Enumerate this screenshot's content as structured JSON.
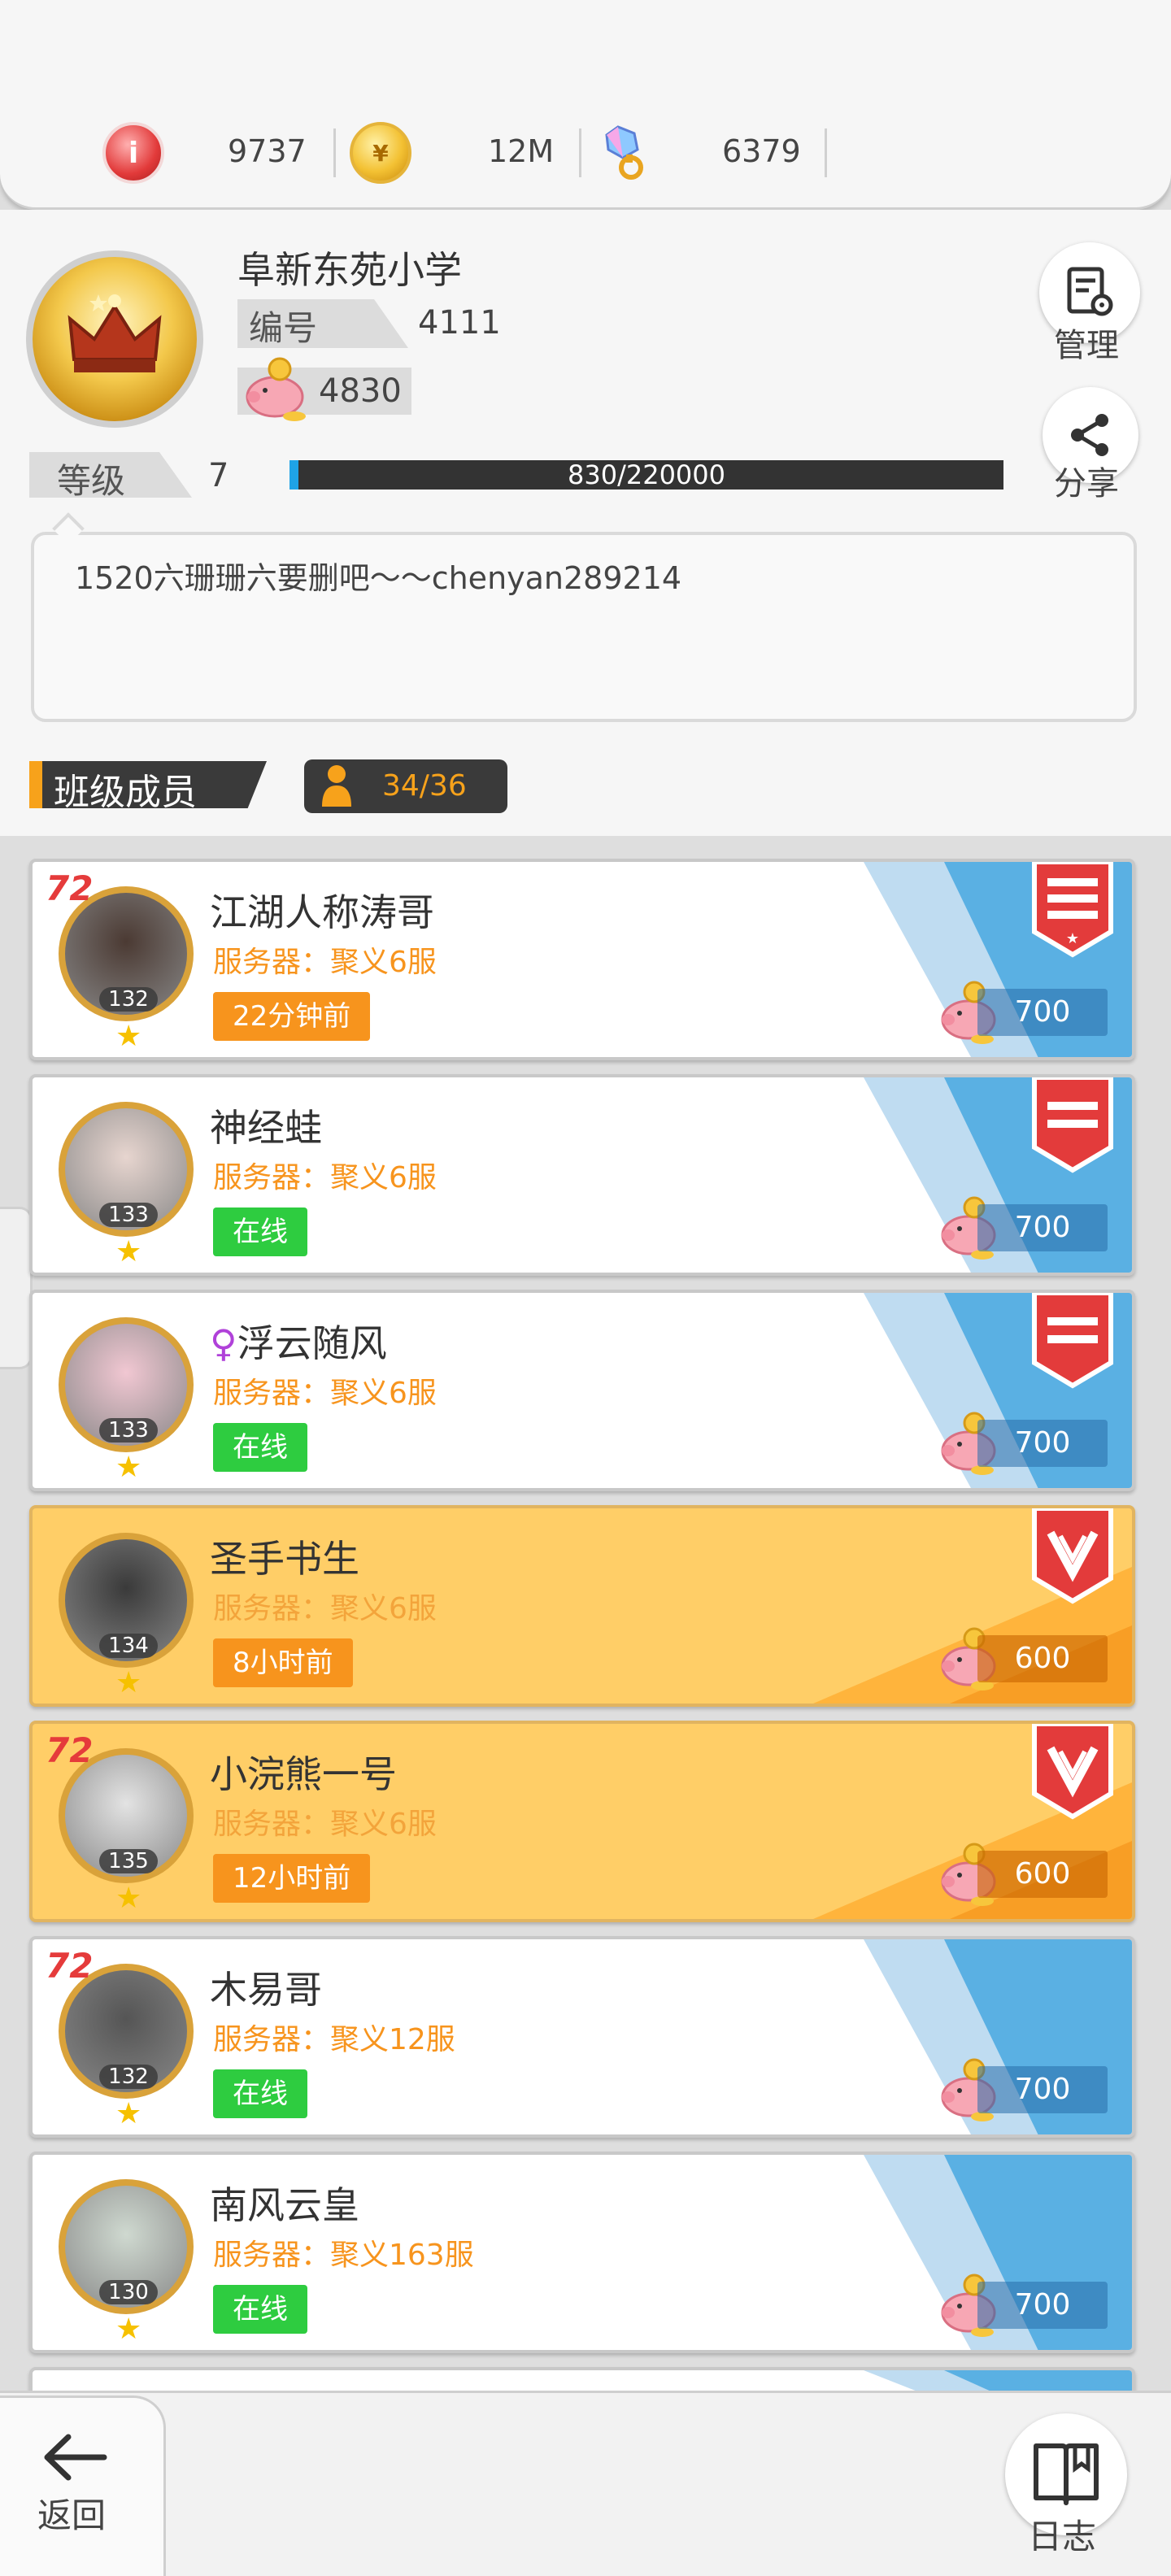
{
  "currencies": [
    {
      "icon": "gem-icon",
      "value": "9737"
    },
    {
      "icon": "gold-coin-icon",
      "value": "12M"
    },
    {
      "icon": "crystal-key-icon",
      "value": "6379"
    }
  ],
  "school": {
    "name": "阜新东苑小学",
    "id_label": "编号",
    "id_value": "4111",
    "pig_value": "4830",
    "level_label": "等级",
    "level_value": "7",
    "xp_text": "830/220000",
    "xp_fraction": 0.0038,
    "manage_label": "管理",
    "share_label": "分享",
    "motto": "1520六珊珊六要删吧～～chenyan289214"
  },
  "members_section": {
    "title": "班级成员",
    "count": "34/36"
  },
  "members": [
    {
      "name": "江湖人称涛哥",
      "server": "服务器：聚义6服",
      "status": "22分钟前",
      "status_type": "away",
      "level": "132",
      "score": "700",
      "vip": "72",
      "role": "leader-icon",
      "card": "white"
    },
    {
      "name": "神经蛙",
      "server": "服务器：聚义6服",
      "status": "在线",
      "status_type": "online",
      "level": "133",
      "score": "700",
      "vip": "",
      "role": "officer-icon",
      "card": "white"
    },
    {
      "name": "浮云随风",
      "server": "服务器：聚义6服",
      "status": "在线",
      "status_type": "online",
      "level": "133",
      "score": "700",
      "vip": "",
      "role": "officer-icon",
      "card": "white",
      "gender": "♀"
    },
    {
      "name": "圣手书生",
      "server": "服务器：聚义6服",
      "status": "8小时前",
      "status_type": "away",
      "level": "134",
      "score": "600",
      "vip": "",
      "role": "elite-icon",
      "card": "gold"
    },
    {
      "name": "小浣熊一号",
      "server": "服务器：聚义6服",
      "status": "12小时前",
      "status_type": "away",
      "level": "135",
      "score": "600",
      "vip": "72",
      "role": "elite-icon",
      "card": "gold"
    },
    {
      "name": "木易哥",
      "server": "服务器：聚义12服",
      "status": "在线",
      "status_type": "online",
      "level": "132",
      "score": "700",
      "vip": "72",
      "role": "",
      "card": "white"
    },
    {
      "name": "南风云皇",
      "server": "服务器：聚义163服",
      "status": "在线",
      "status_type": "online",
      "level": "130",
      "score": "700",
      "vip": "",
      "role": "",
      "card": "white"
    }
  ],
  "bottom": {
    "back_label": "返回",
    "log_label": "日志"
  },
  "colors": {
    "accent_orange": "#f7941d",
    "online_green": "#2ecc40",
    "card_gold": "#ffce67",
    "card_blue": "#5ab0e3"
  }
}
